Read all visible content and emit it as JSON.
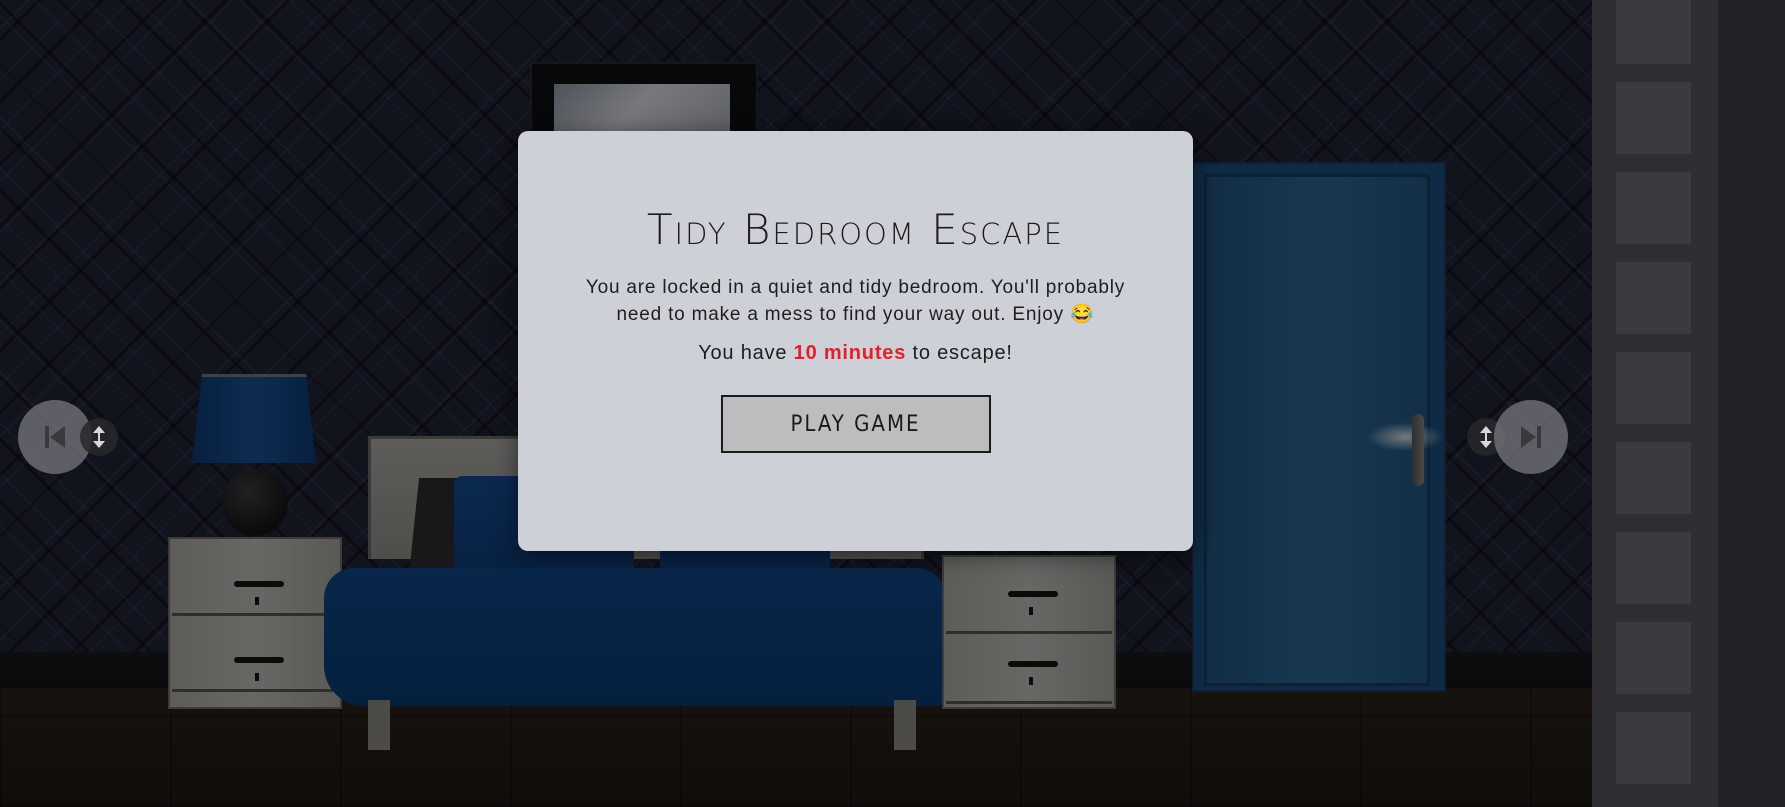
{
  "modal": {
    "title": "Tidy Bedroom Escape",
    "description": "You are locked in a quiet and tidy bedroom. You'll probably need to make a mess to find your way out. Enjoy",
    "emoji": "😂",
    "timer_prefix": "You have",
    "timer_value": "10 minutes",
    "timer_suffix": "to escape!",
    "play_button": "PLAY GAME"
  },
  "navigation": {
    "prev_icon": "skip-previous-icon",
    "next_icon": "skip-next-icon",
    "drag_icon": "vertical-arrows-icon"
  },
  "inventory": {
    "slot_count": 9
  },
  "colors": {
    "modal_background": "#cdd0d7",
    "timer_accent": "#e0202a",
    "button_background": "#bdbdbf"
  }
}
